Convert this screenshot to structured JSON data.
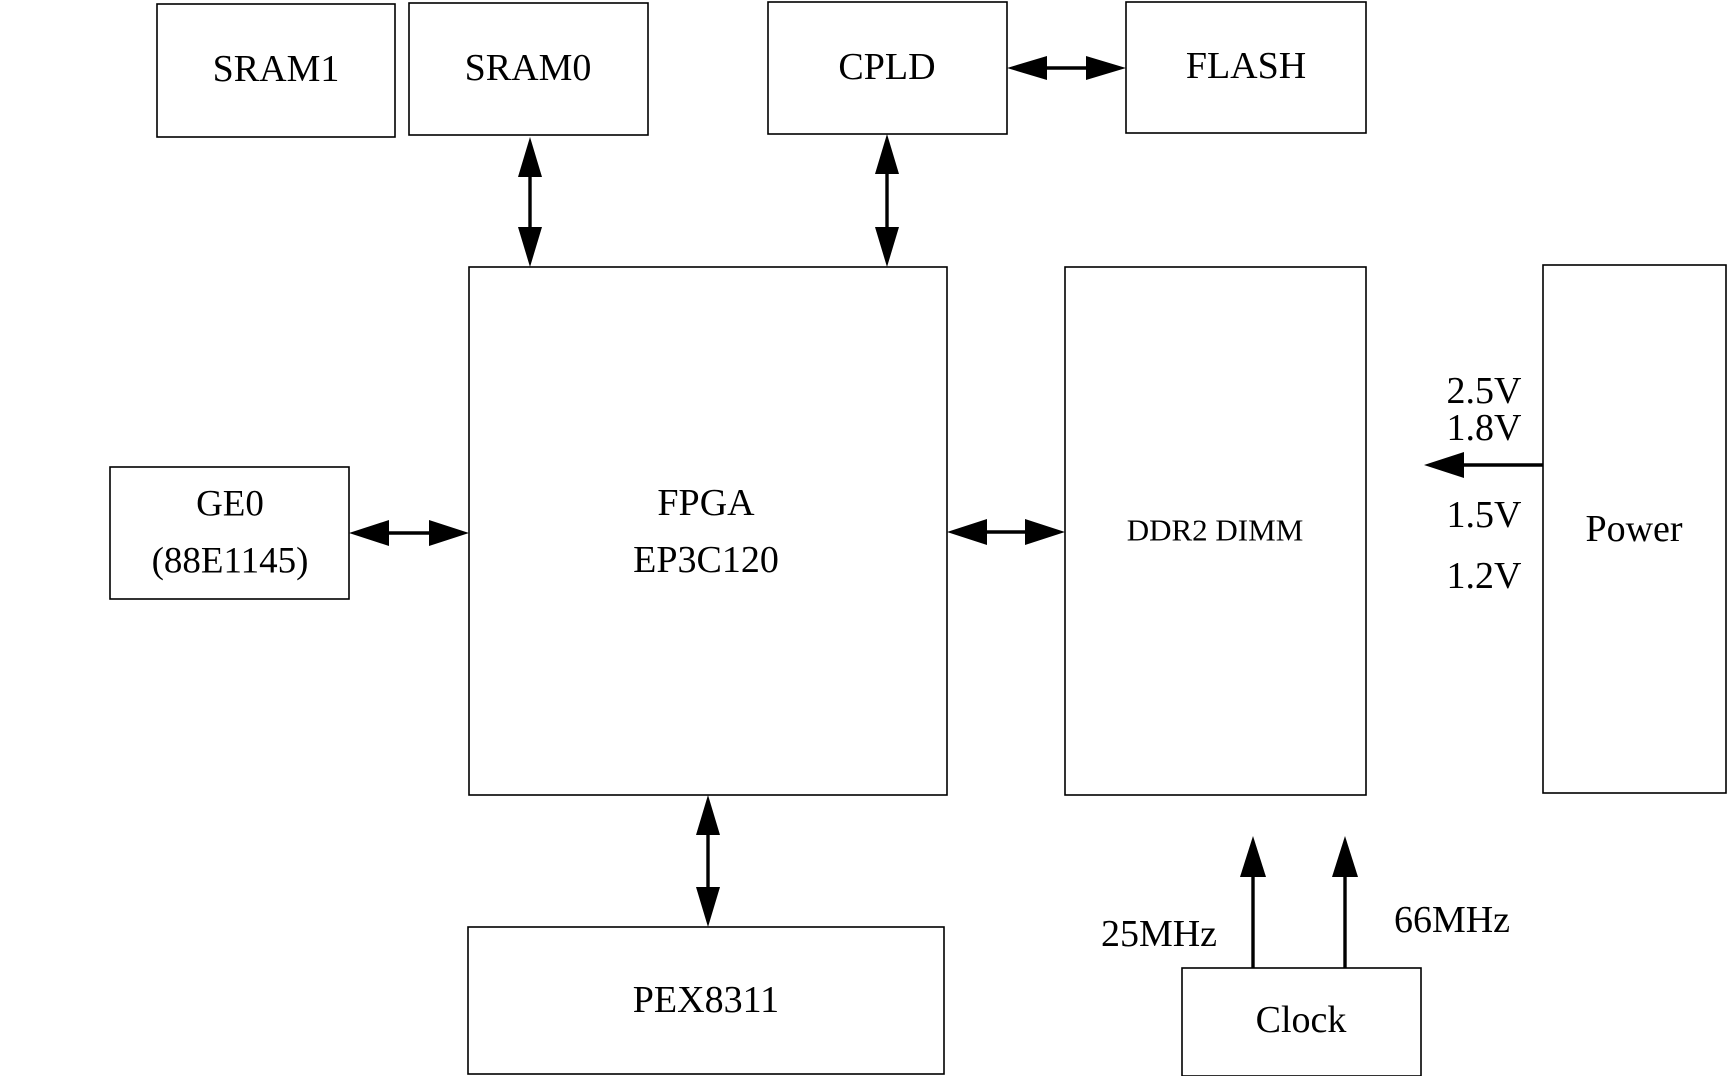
{
  "diagram": {
    "type": "hardware-block-diagram",
    "blocks": {
      "sram1": "SRAM1",
      "sram0": "SRAM0",
      "cpld": "CPLD",
      "flash": "FLASH",
      "fpga_line1": "FPGA",
      "fpga_line2": "EP3C120",
      "ddr2": "DDR2 DIMM",
      "power": "Power",
      "ge0_line1": "GE0",
      "ge0_line2": "(88E1145)",
      "pex": "PEX8311",
      "clock": "Clock"
    },
    "voltages": [
      "2.5V",
      "1.8V",
      "1.5V",
      "1.2V"
    ],
    "clocks": [
      "25MHz",
      "66MHz"
    ],
    "connections": [
      {
        "from": "SRAM0",
        "to": "FPGA",
        "direction": "bidirectional"
      },
      {
        "from": "CPLD",
        "to": "FPGA",
        "direction": "bidirectional"
      },
      {
        "from": "CPLD",
        "to": "FLASH",
        "direction": "bidirectional"
      },
      {
        "from": "GE0",
        "to": "FPGA",
        "direction": "bidirectional"
      },
      {
        "from": "FPGA",
        "to": "DDR2 DIMM",
        "direction": "bidirectional"
      },
      {
        "from": "FPGA",
        "to": "PEX8311",
        "direction": "bidirectional"
      },
      {
        "from": "Power",
        "to": "DDR2 DIMM",
        "direction": "one-way"
      },
      {
        "from": "Clock",
        "to": "DDR2 DIMM",
        "direction": "one-way",
        "label": "25MHz"
      },
      {
        "from": "Clock",
        "to": "DDR2 DIMM",
        "direction": "one-way",
        "label": "66MHz"
      }
    ]
  }
}
